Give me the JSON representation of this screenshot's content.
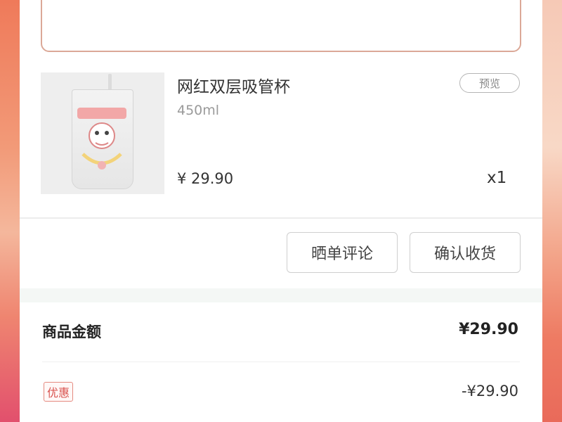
{
  "product": {
    "title": "网红双层吸管杯",
    "spec": "450ml",
    "price": "¥ 29.90",
    "quantity": "x1",
    "preview_label": "预览",
    "image_icon": "cup-image"
  },
  "actions": {
    "review_label": "晒单评论",
    "confirm_label": "确认收货"
  },
  "summary": {
    "goods_amount_label": "商品金额",
    "goods_amount_value": "¥29.90",
    "discount_badge": "优惠",
    "discount_value": "-¥29.90"
  },
  "colors": {
    "accent": "#d9534f",
    "border": "#cfcfcf"
  }
}
